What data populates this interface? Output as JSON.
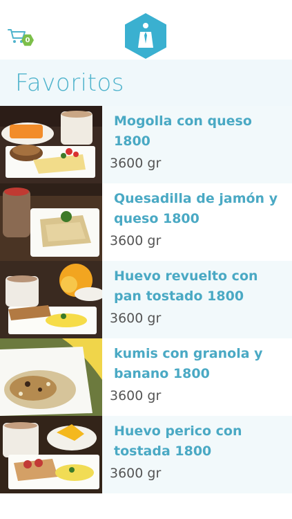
{
  "header": {
    "cart_count": "0",
    "cart_icon": "shopping-cart-icon",
    "logo_icon": "hexagon-person-logo"
  },
  "section": {
    "title": "Favoritos"
  },
  "colors": {
    "accent": "#4fb3cc",
    "badge": "#7cbf4a",
    "row_alt": "#f2f9fb"
  },
  "items": [
    {
      "name": "Mogolla con queso 1800",
      "weight": "3600 gr"
    },
    {
      "name": "Quesadilla de jamón y queso 1800",
      "weight": "3600 gr"
    },
    {
      "name": "Huevo revuelto con pan tostado 1800",
      "weight": "3600 gr"
    },
    {
      "name": "kumis con granola y banano 1800",
      "weight": "3600 gr"
    },
    {
      "name": "Huevo perico con tostada 1800",
      "weight": "3600 gr"
    }
  ]
}
